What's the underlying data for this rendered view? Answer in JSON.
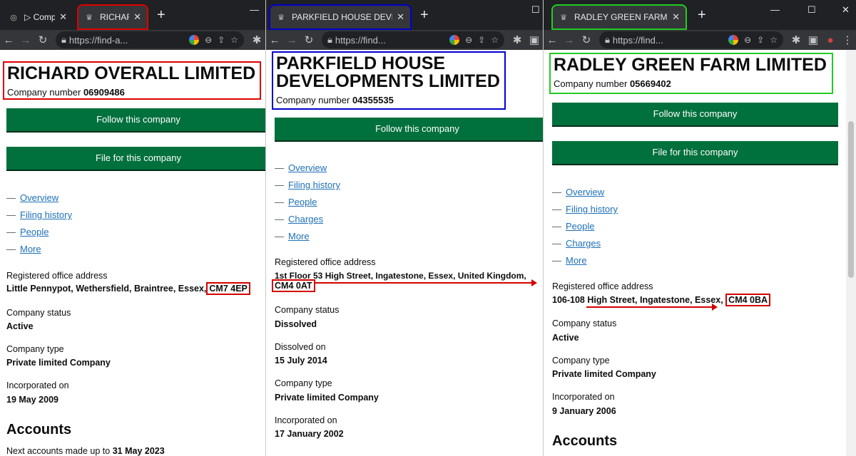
{
  "w1": {
    "tabs": [
      {
        "label": "▷ Compa"
      },
      {
        "label": "RICHARD"
      }
    ],
    "url": "https://find-a...",
    "title": "RICHARD OVERALL LIMITED",
    "company_number_label": "Company number",
    "company_number": "06909486",
    "follow": "Follow this company",
    "file": "File for this company",
    "nav": [
      "Overview",
      "Filing history",
      "People",
      "More"
    ],
    "address_label": "Registered office address",
    "address_main": "Little Pennypot, Wethersfield, Braintree, Essex,",
    "postcode": "CM7 4EP",
    "status_label": "Company status",
    "status": "Active",
    "type_label": "Company type",
    "type": "Private limited Company",
    "inc_label": "Incorporated on",
    "inc": "19 May 2009",
    "accounts": "Accounts",
    "next_accounts_label": "Next accounts made up to",
    "next_accounts": "31 May 2023"
  },
  "w2": {
    "tab": "PARKFIELD HOUSE DEVELOPM",
    "url": "https://find...",
    "title1": "PARKFIELD HOUSE",
    "title2": "DEVELOPMENTS LIMITED",
    "company_number_label": "Company number",
    "company_number": "04355535",
    "follow": "Follow this company",
    "nav": [
      "Overview",
      "Filing history",
      "People",
      "Charges",
      "More"
    ],
    "address_label": "Registered office address",
    "address_main": "1st Floor 53 High Street, Ingatestone, Essex, United Kingdom,",
    "postcode": "CM4 0AT",
    "status_label": "Company status",
    "status": "Dissolved",
    "dissolved_label": "Dissolved on",
    "dissolved": "15 July 2014",
    "type_label": "Company type",
    "type": "Private limited Company",
    "inc_label": "Incorporated on",
    "inc": "17 January 2002"
  },
  "w3": {
    "tab": "RADLEY GREEN FARM LIMITED",
    "url": "https://find...",
    "title": "RADLEY GREEN FARM LIMITED",
    "company_number_label": "Company number",
    "company_number": "05669402",
    "follow": "Follow this company",
    "file": "File for this company",
    "nav": [
      "Overview",
      "Filing history",
      "People",
      "Charges",
      "More"
    ],
    "address_label": "Registered office address",
    "address_main": "106-108 High Street, Ingatestone, Essex,",
    "postcode": "CM4 0BA",
    "status_label": "Company status",
    "status": "Active",
    "type_label": "Company type",
    "type": "Private limited Company",
    "inc_label": "Incorporated on",
    "inc": "9 January 2006",
    "accounts": "Accounts",
    "window_controls": [
      "—",
      "☐",
      "✕"
    ]
  },
  "colors": {
    "box1": "#e00000",
    "box2": "#0000cc",
    "box3": "#22cc22",
    "govuk_green": "#00703c",
    "link": "#1d70b8"
  }
}
